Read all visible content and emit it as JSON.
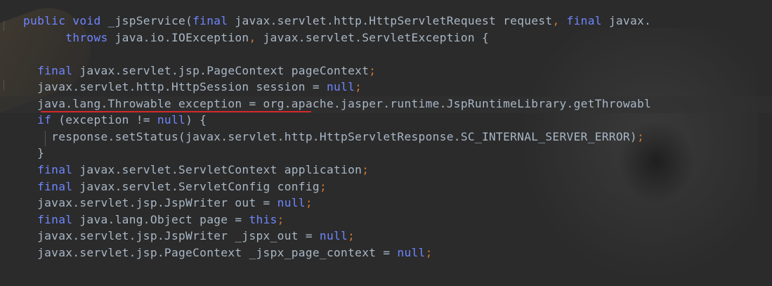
{
  "code_lines": [
    [
      {
        "t": "public",
        "c": "kw"
      },
      {
        "t": " ",
        "c": "pl"
      },
      {
        "t": "void",
        "c": "kw"
      },
      {
        "t": " _jspService(",
        "c": "pl"
      },
      {
        "t": "final",
        "c": "kw"
      },
      {
        "t": " javax.servlet.http.HttpServletRequest request",
        "c": "pl"
      },
      {
        "t": ",",
        "c": "pu"
      },
      {
        "t": " ",
        "c": "pl"
      },
      {
        "t": "final",
        "c": "kw"
      },
      {
        "t": " javax.",
        "c": "pl"
      }
    ],
    [
      {
        "t": "      ",
        "c": "pl"
      },
      {
        "t": "throws",
        "c": "kw"
      },
      {
        "t": " java.io.IOException",
        "c": "pl"
      },
      {
        "t": ",",
        "c": "pu"
      },
      {
        "t": " javax.servlet.ServletException {",
        "c": "pl"
      }
    ],
    [],
    [
      {
        "t": "  ",
        "c": "pl"
      },
      {
        "t": "final",
        "c": "kw"
      },
      {
        "t": " javax.servlet.jsp.PageContext pageContext",
        "c": "pl"
      },
      {
        "t": ";",
        "c": "pu"
      }
    ],
    [
      {
        "t": "  javax.servlet.http.HttpSession session = ",
        "c": "pl"
      },
      {
        "t": "null",
        "c": "kw"
      },
      {
        "t": ";",
        "c": "pu"
      }
    ],
    [
      {
        "t": "  java.lang.Throwable exception = org.apache.jasper.runtime.JspRuntimeLibrary.getThrowabl",
        "c": "pl"
      }
    ],
    [
      {
        "t": "  ",
        "c": "pl"
      },
      {
        "t": "if",
        "c": "kw"
      },
      {
        "t": " (exception != ",
        "c": "pl"
      },
      {
        "t": "null",
        "c": "kw"
      },
      {
        "t": ") {",
        "c": "pl"
      }
    ],
    [
      {
        "t": "    response.setStatus(javax.servlet.http.HttpServletResponse.SC_INTERNAL_SERVER_ERROR)",
        "c": "pl"
      },
      {
        "t": ";",
        "c": "pu"
      }
    ],
    [
      {
        "t": "  }",
        "c": "pl"
      }
    ],
    [
      {
        "t": "  ",
        "c": "pl"
      },
      {
        "t": "final",
        "c": "kw"
      },
      {
        "t": " javax.servlet.ServletContext application",
        "c": "pl"
      },
      {
        "t": ";",
        "c": "pu"
      }
    ],
    [
      {
        "t": "  ",
        "c": "pl"
      },
      {
        "t": "final",
        "c": "kw"
      },
      {
        "t": " javax.servlet.ServletConfig config",
        "c": "pl"
      },
      {
        "t": ";",
        "c": "pu"
      }
    ],
    [
      {
        "t": "  javax.servlet.jsp.JspWriter out = ",
        "c": "pl"
      },
      {
        "t": "null",
        "c": "kw"
      },
      {
        "t": ";",
        "c": "pu"
      }
    ],
    [
      {
        "t": "  ",
        "c": "pl"
      },
      {
        "t": "final",
        "c": "kw"
      },
      {
        "t": " java.lang.Object page = ",
        "c": "pl"
      },
      {
        "t": "this",
        "c": "kw"
      },
      {
        "t": ";",
        "c": "pu"
      }
    ],
    [
      {
        "t": "  javax.servlet.jsp.JspWriter _jspx_out = ",
        "c": "pl"
      },
      {
        "t": "null",
        "c": "kw"
      },
      {
        "t": ";",
        "c": "pu"
      }
    ],
    [
      {
        "t": "  javax.servlet.jsp.PageContext _jspx_page_context = ",
        "c": "pl"
      },
      {
        "t": "null",
        "c": "kw"
      },
      {
        "t": ";",
        "c": "pu"
      }
    ]
  ],
  "colors": {
    "background": "#2b2b2b",
    "keyword": "#6f86ff",
    "plain": "#a9b7c6",
    "punctuation": "#cc7832",
    "underline": "#d4282c"
  }
}
